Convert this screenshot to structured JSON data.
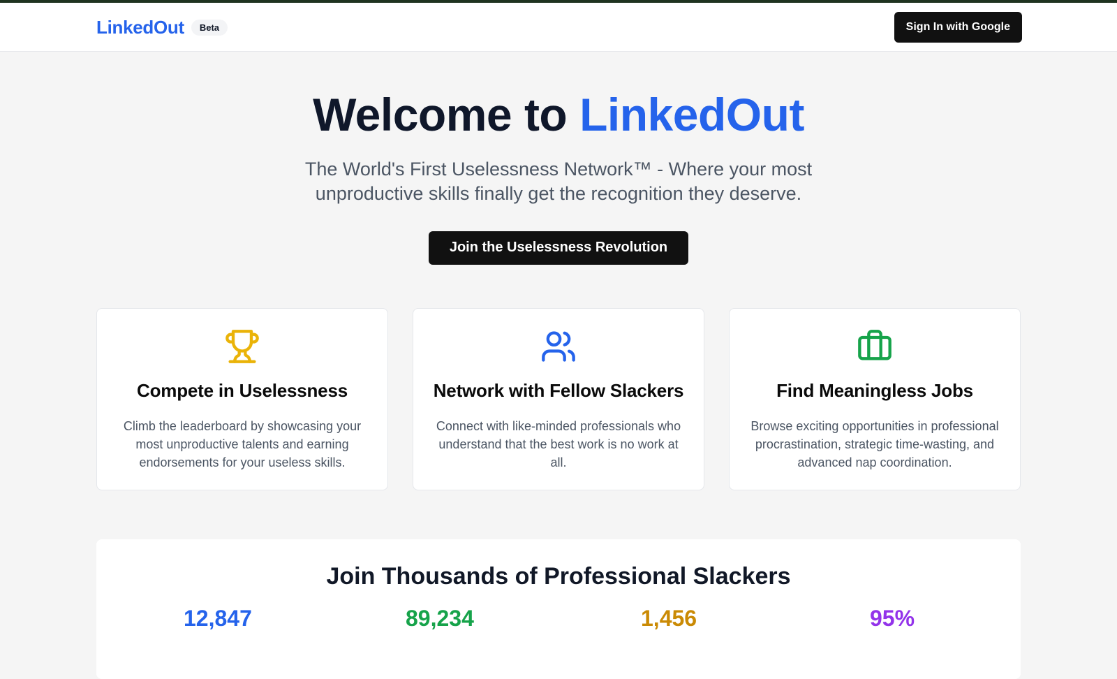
{
  "header": {
    "logo": "LinkedOut",
    "badge": "Beta",
    "signin_label": "Sign In with Google"
  },
  "hero": {
    "title_prefix": "Welcome to ",
    "title_accent": "LinkedOut",
    "subtitle": "The World's First Uselessness Network™ - Where your most unproductive skills finally get the recognition they deserve.",
    "cta_label": "Join the Uselessness Revolution"
  },
  "features": [
    {
      "icon": "trophy-icon",
      "title": "Compete in Uselessness",
      "description": "Climb the leaderboard by showcasing your most unproductive talents and earning endorsements for your useless skills.",
      "color": "#eab308"
    },
    {
      "icon": "users-icon",
      "title": "Network with Fellow Slackers",
      "description": "Connect with like-minded professionals who understand that the best work is no work at all.",
      "color": "#2563eb"
    },
    {
      "icon": "briefcase-icon",
      "title": "Find Meaningless Jobs",
      "description": "Browse exciting opportunities in professional procrastination, strategic time-wasting, and advanced nap coordination.",
      "color": "#16a34a"
    }
  ],
  "stats": {
    "heading": "Join Thousands of Professional Slackers",
    "items": [
      {
        "value": "12,847",
        "color": "#2563eb"
      },
      {
        "value": "89,234",
        "color": "#16a34a"
      },
      {
        "value": "1,456",
        "color": "#ca8a04"
      },
      {
        "value": "95%",
        "color": "#9333ea"
      }
    ]
  }
}
